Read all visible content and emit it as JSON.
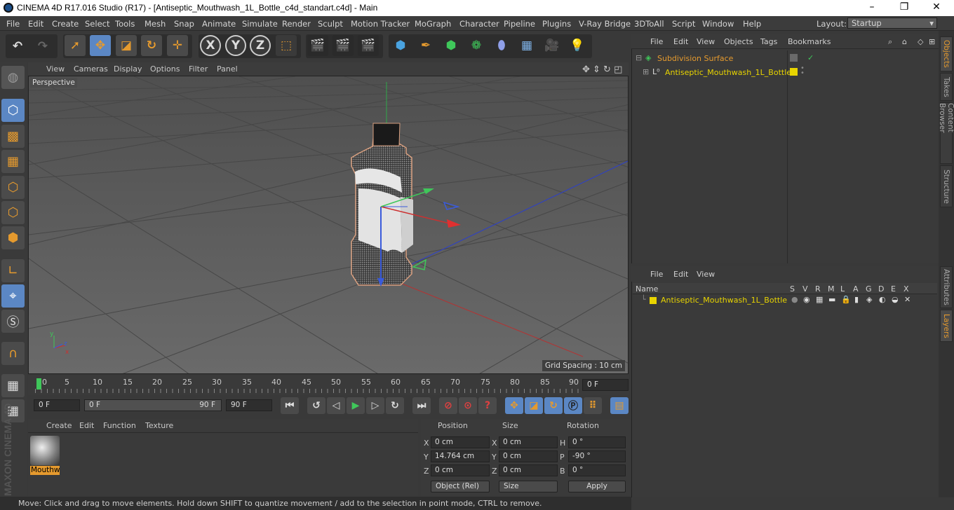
{
  "window": {
    "title": "CINEMA 4D R17.016 Studio (R17) - [Antiseptic_Mouthwash_1L_Bottle_c4d_standart.c4d] - Main",
    "minimize": "–",
    "maximize": "❐",
    "close": "✕"
  },
  "menubar": {
    "items": [
      "File",
      "Edit",
      "Create",
      "Select",
      "Tools",
      "Mesh",
      "Snap",
      "Animate",
      "Simulate",
      "Render",
      "Sculpt",
      "Motion Tracker",
      "MoGraph",
      "Character",
      "Pipeline",
      "Plugins",
      "V-Ray Bridge",
      "3DToAll",
      "Script",
      "Window",
      "Help"
    ],
    "layout_label": "Layout:",
    "layout_value": "Startup"
  },
  "toolbar": {
    "axis_x": "X",
    "axis_y": "Y",
    "axis_z": "Z"
  },
  "viewport": {
    "menu": [
      "View",
      "Cameras",
      "Display",
      "Options",
      "Filter",
      "Panel"
    ],
    "label": "Perspective",
    "grid_spacing": "Grid Spacing : 10 cm",
    "axis_y": "y",
    "axis_x": "x",
    "axis_z": "z"
  },
  "timeline": {
    "ticks": [
      "0",
      "5",
      "10",
      "15",
      "20",
      "25",
      "30",
      "35",
      "40",
      "45",
      "50",
      "55",
      "60",
      "65",
      "70",
      "75",
      "80",
      "85",
      "90"
    ],
    "current_frame": "0 F"
  },
  "transport": {
    "start": "0 F",
    "range_start": "0 F",
    "range_end": "90 F",
    "end": "90 F"
  },
  "material": {
    "menu": [
      "Create",
      "Edit",
      "Function",
      "Texture"
    ],
    "name": "Mouthw"
  },
  "coords": {
    "headers": [
      "Position",
      "Size",
      "Rotation"
    ],
    "rows": [
      {
        "a": "X",
        "p": "0 cm",
        "b": "X",
        "s": "0 cm",
        "c": "H",
        "r": "0 °"
      },
      {
        "a": "Y",
        "p": "14.764 cm",
        "b": "Y",
        "s": "0 cm",
        "c": "P",
        "r": "-90 °"
      },
      {
        "a": "Z",
        "p": "0 cm",
        "b": "Z",
        "s": "0 cm",
        "c": "B",
        "r": "0 °"
      }
    ],
    "mode": "Object (Rel)",
    "size_mode": "Size",
    "apply": "Apply"
  },
  "status": "Move: Click and drag to move elements. Hold down SHIFT to quantize movement / add to the selection in point mode, CTRL to remove.",
  "objects": {
    "menu": [
      "File",
      "Edit",
      "View",
      "Objects",
      "Tags",
      "Bookmarks"
    ],
    "items": [
      {
        "name": "Subdivision Surface"
      },
      {
        "name": "Antiseptic_Mouthwash_1L_Bottle"
      }
    ]
  },
  "layers": {
    "menu": [
      "File",
      "Edit",
      "View"
    ],
    "headers": [
      "Name",
      "S",
      "V",
      "R",
      "M",
      "L",
      "A",
      "G",
      "D",
      "E",
      "X"
    ],
    "item": "Antiseptic_Mouthwash_1L_Bottle"
  },
  "right_tabs": [
    "Objects",
    "Takes",
    "Content Browser",
    "Structure",
    "Attributes",
    "Layers"
  ],
  "brand": "MAXON CINEMA 4D",
  "colors": {
    "accent": "#5b87c4",
    "orange": "#e59a2e",
    "yellow": "#e8d400"
  }
}
